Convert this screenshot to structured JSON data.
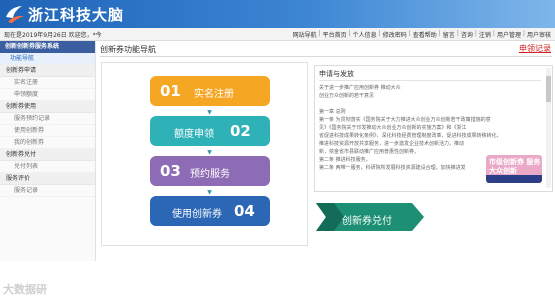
{
  "header": {
    "logo_text": "浙江科技大脑"
  },
  "topbar": {
    "welcome": "现在是2019年9月26日 欢迎您，*今",
    "nav": [
      "网站导航",
      "平台首页",
      "个人信息",
      "修改密码",
      "查看帮助",
      "留言",
      "咨询",
      "注销",
      "用户管理",
      "用户审核"
    ]
  },
  "sidebar": {
    "title": "创新创新券服务系统",
    "items": [
      {
        "type": "item",
        "label": "功能导航",
        "active": true
      },
      {
        "type": "section",
        "label": "创新券申请"
      },
      {
        "type": "sub",
        "label": "实名注册"
      },
      {
        "type": "sub",
        "label": "申领额度"
      },
      {
        "type": "section",
        "label": "创新券使用"
      },
      {
        "type": "sub",
        "label": "服务预约记录"
      },
      {
        "type": "sub",
        "label": "使用创新券"
      },
      {
        "type": "sub",
        "label": "我的创新券"
      },
      {
        "type": "section",
        "label": "创新券兑付"
      },
      {
        "type": "sub",
        "label": "兑付列表"
      },
      {
        "type": "section",
        "label": "服务评价"
      },
      {
        "type": "sub",
        "label": "服务记录"
      }
    ]
  },
  "watermark": "大数据研",
  "main": {
    "title": "创新券功能导航",
    "record_link": "申领记录"
  },
  "steps": [
    {
      "num": "01",
      "label": "实名注册",
      "color": "#f5a623"
    },
    {
      "num": "02",
      "label": "额度申领",
      "color": "#2eb2b8"
    },
    {
      "num": "03",
      "label": "预约服务",
      "color": "#8e6bb5"
    },
    {
      "num": "04",
      "label": "使用创新券",
      "color": "#2b67b4"
    }
  ],
  "info": {
    "title": "申请与发放",
    "lines": [
      "关于进一步推广应用创新券 推动大众",
      "创业万众创新的若干意见",
      "",
      "第一章 总则",
      "第一条 为贯彻落实《国务院关于大力推进大众创业万众创新若干政策措施的意",
      "见》《国务院关于印发推动大众创业万众创新的实施方案》和《浙江",
      "省促进科技成果转化条例》，深化科技经费管理制度改革，促进科技成果转移转化，",
      "推进科技资源开放共享服务，进一步激发企业技术创新活力，推动",
      "新，依金省市县联动推广应用普惠性创新券，",
      "第二条 推进科技服务，",
      "第二条 两带一服务，科研院所发展科技资源建设合理，加快推进发"
    ]
  },
  "promo": {
    "text": "市级创新券 服务大众创新"
  },
  "pay_button": {
    "label": "创新券兑付"
  }
}
